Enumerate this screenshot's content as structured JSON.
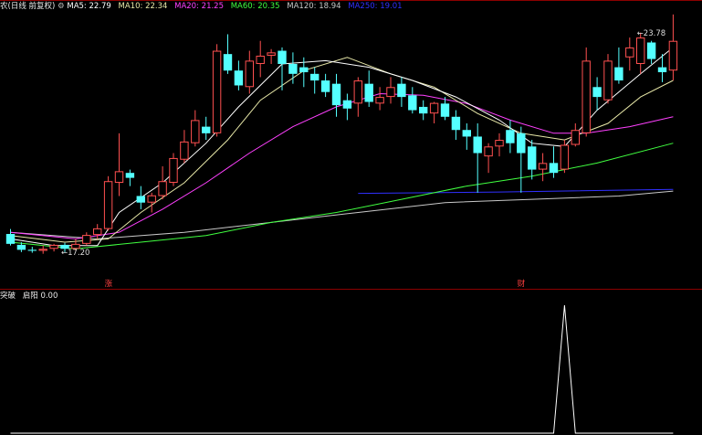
{
  "header": {
    "title": "农(日线 前复权)",
    "ma5": "MA5: 22.79",
    "ma10": "MA10: 22.34",
    "ma20": "MA20: 21.25",
    "ma60": "MA60: 20.35",
    "ma120": "MA120: 18.94",
    "ma250": "MA250: 19.01"
  },
  "sub_header": {
    "name": "突破",
    "label": "启阳",
    "value": "0.00"
  },
  "colors": {
    "up": "#ff5050",
    "down": "#54ffff",
    "ma5": "#ffffff",
    "ma10": "#e8e8a8",
    "ma20": "#ff40ff",
    "ma60": "#40ff40",
    "ma120": "#c8c8c8",
    "ma250": "#3030ff"
  },
  "chart_data": [
    {
      "type": "candlestick",
      "ylim": [
        16.2,
        24.45
      ],
      "annotations": [
        {
          "text": "23.78",
          "index": 58,
          "value": 23.78
        },
        {
          "text": "17.20",
          "index": 5,
          "value": 17.2
        }
      ],
      "markers": [
        {
          "text": "涨",
          "index": 9
        },
        {
          "text": "财",
          "index": 47
        }
      ],
      "ohlc": [
        [
          17.75,
          17.9,
          17.4,
          17.45
        ],
        [
          17.42,
          17.5,
          17.2,
          17.27
        ],
        [
          17.27,
          17.36,
          17.18,
          17.24
        ],
        [
          17.24,
          17.4,
          17.15,
          17.3
        ],
        [
          17.3,
          17.45,
          17.22,
          17.42
        ],
        [
          17.42,
          17.48,
          17.2,
          17.3
        ],
        [
          17.3,
          17.6,
          17.25,
          17.45
        ],
        [
          17.45,
          17.8,
          17.4,
          17.72
        ],
        [
          17.72,
          18.05,
          17.6,
          17.92
        ],
        [
          17.9,
          19.5,
          17.85,
          19.35
        ],
        [
          19.3,
          20.8,
          18.9,
          19.65
        ],
        [
          19.6,
          19.7,
          19.2,
          19.45
        ],
        [
          18.9,
          19.2,
          18.5,
          18.7
        ],
        [
          18.7,
          19.0,
          18.4,
          18.92
        ],
        [
          18.9,
          19.8,
          18.8,
          19.35
        ],
        [
          19.3,
          20.2,
          19.2,
          20.05
        ],
        [
          20.0,
          20.9,
          19.9,
          20.55
        ],
        [
          20.5,
          21.5,
          20.4,
          21.2
        ],
        [
          21.0,
          21.3,
          20.6,
          20.8
        ],
        [
          20.8,
          23.5,
          20.7,
          23.3
        ],
        [
          23.2,
          23.8,
          22.6,
          22.7
        ],
        [
          22.7,
          23.0,
          22.1,
          22.25
        ],
        [
          22.2,
          23.3,
          22.0,
          23.0
        ],
        [
          22.9,
          23.6,
          22.5,
          23.15
        ],
        [
          23.15,
          23.35,
          22.9,
          23.25
        ],
        [
          23.3,
          23.4,
          22.1,
          22.9
        ],
        [
          22.9,
          23.25,
          22.3,
          22.6
        ],
        [
          22.8,
          23.1,
          22.2,
          22.65
        ],
        [
          22.6,
          22.8,
          22.0,
          22.4
        ],
        [
          22.4,
          22.6,
          21.9,
          22.05
        ],
        [
          22.3,
          22.6,
          21.3,
          21.65
        ],
        [
          21.8,
          22.0,
          21.2,
          21.55
        ],
        [
          21.7,
          22.5,
          21.3,
          22.4
        ],
        [
          22.3,
          22.7,
          21.6,
          21.75
        ],
        [
          21.7,
          22.2,
          21.5,
          21.9
        ],
        [
          21.9,
          22.5,
          21.7,
          22.2
        ],
        [
          22.3,
          22.5,
          21.6,
          21.9
        ],
        [
          21.95,
          22.2,
          21.4,
          21.5
        ],
        [
          21.6,
          21.8,
          21.2,
          21.4
        ],
        [
          21.4,
          21.75,
          21.1,
          21.72
        ],
        [
          21.7,
          21.9,
          21.2,
          21.3
        ],
        [
          21.3,
          21.5,
          20.6,
          20.9
        ],
        [
          20.9,
          21.1,
          20.3,
          20.7
        ],
        [
          20.7,
          21.1,
          19.0,
          20.2
        ],
        [
          20.1,
          20.5,
          19.6,
          20.4
        ],
        [
          20.4,
          20.8,
          20.1,
          20.6
        ],
        [
          20.9,
          21.2,
          20.2,
          20.5
        ],
        [
          20.8,
          21.0,
          19.0,
          20.2
        ],
        [
          20.4,
          20.6,
          19.4,
          19.7
        ],
        [
          19.7,
          20.2,
          19.35,
          19.9
        ],
        [
          19.9,
          20.4,
          19.45,
          19.6
        ],
        [
          19.7,
          20.6,
          19.6,
          20.45
        ],
        [
          20.45,
          21.1,
          20.4,
          20.9
        ],
        [
          20.8,
          23.4,
          20.7,
          23.0
        ],
        [
          22.2,
          22.5,
          21.5,
          21.9
        ],
        [
          21.8,
          23.2,
          21.7,
          23.0
        ],
        [
          22.8,
          23.4,
          22.3,
          22.4
        ],
        [
          23.1,
          23.7,
          22.7,
          23.4
        ],
        [
          22.9,
          23.85,
          22.6,
          23.7
        ],
        [
          23.55,
          23.6,
          22.9,
          23.05
        ],
        [
          22.8,
          23.2,
          22.35,
          22.65
        ],
        [
          22.7,
          24.4,
          22.4,
          23.6
        ]
      ],
      "ma": {
        "ma5": [
          [
            0,
            17.6
          ],
          [
            4,
            17.4
          ],
          [
            8,
            17.4
          ],
          [
            10,
            18.4
          ],
          [
            14,
            19.3
          ],
          [
            18,
            20.5
          ],
          [
            21,
            21.6
          ],
          [
            25,
            22.9
          ],
          [
            29,
            23.0
          ],
          [
            33,
            22.8
          ],
          [
            37,
            22.4
          ],
          [
            41,
            21.9
          ],
          [
            45,
            21.2
          ],
          [
            48,
            20.5
          ],
          [
            51,
            20.4
          ],
          [
            54,
            21.5
          ],
          [
            58,
            22.6
          ],
          [
            61,
            23.4
          ]
        ],
        "ma10": [
          [
            0,
            17.7
          ],
          [
            5,
            17.5
          ],
          [
            9,
            17.6
          ],
          [
            12,
            18.4
          ],
          [
            16,
            19.3
          ],
          [
            20,
            20.6
          ],
          [
            23,
            21.8
          ],
          [
            27,
            22.7
          ],
          [
            31,
            23.1
          ],
          [
            35,
            22.6
          ],
          [
            39,
            22.2
          ],
          [
            43,
            21.4
          ],
          [
            47,
            20.8
          ],
          [
            51,
            20.6
          ],
          [
            55,
            21.1
          ],
          [
            58,
            21.9
          ],
          [
            61,
            22.4
          ]
        ],
        "ma20": [
          [
            0,
            17.8
          ],
          [
            6,
            17.6
          ],
          [
            10,
            17.8
          ],
          [
            14,
            18.5
          ],
          [
            18,
            19.3
          ],
          [
            22,
            20.2
          ],
          [
            26,
            21.0
          ],
          [
            30,
            21.6
          ],
          [
            34,
            22.0
          ],
          [
            38,
            21.95
          ],
          [
            42,
            21.7
          ],
          [
            46,
            21.2
          ],
          [
            50,
            20.8
          ],
          [
            53,
            20.8
          ],
          [
            57,
            21.0
          ],
          [
            61,
            21.3
          ]
        ],
        "ma60": [
          [
            0,
            17.5
          ],
          [
            6,
            17.3
          ],
          [
            12,
            17.5
          ],
          [
            18,
            17.7
          ],
          [
            24,
            18.1
          ],
          [
            30,
            18.4
          ],
          [
            36,
            18.8
          ],
          [
            42,
            19.2
          ],
          [
            48,
            19.5
          ],
          [
            54,
            19.9
          ],
          [
            61,
            20.5
          ]
        ],
        "ma120": [
          [
            0,
            17.8
          ],
          [
            8,
            17.6
          ],
          [
            16,
            17.8
          ],
          [
            24,
            18.1
          ],
          [
            32,
            18.4
          ],
          [
            40,
            18.7
          ],
          [
            48,
            18.8
          ],
          [
            56,
            18.9
          ],
          [
            61,
            19.05
          ]
        ],
        "ma250": [
          [
            32,
            18.98
          ],
          [
            45,
            19.02
          ],
          [
            61,
            19.1
          ]
        ]
      }
    },
    {
      "type": "line",
      "ylim": [
        0,
        1
      ],
      "x": [
        0,
        50,
        51,
        52,
        61
      ],
      "values": [
        0,
        0,
        1,
        0,
        0
      ]
    }
  ]
}
